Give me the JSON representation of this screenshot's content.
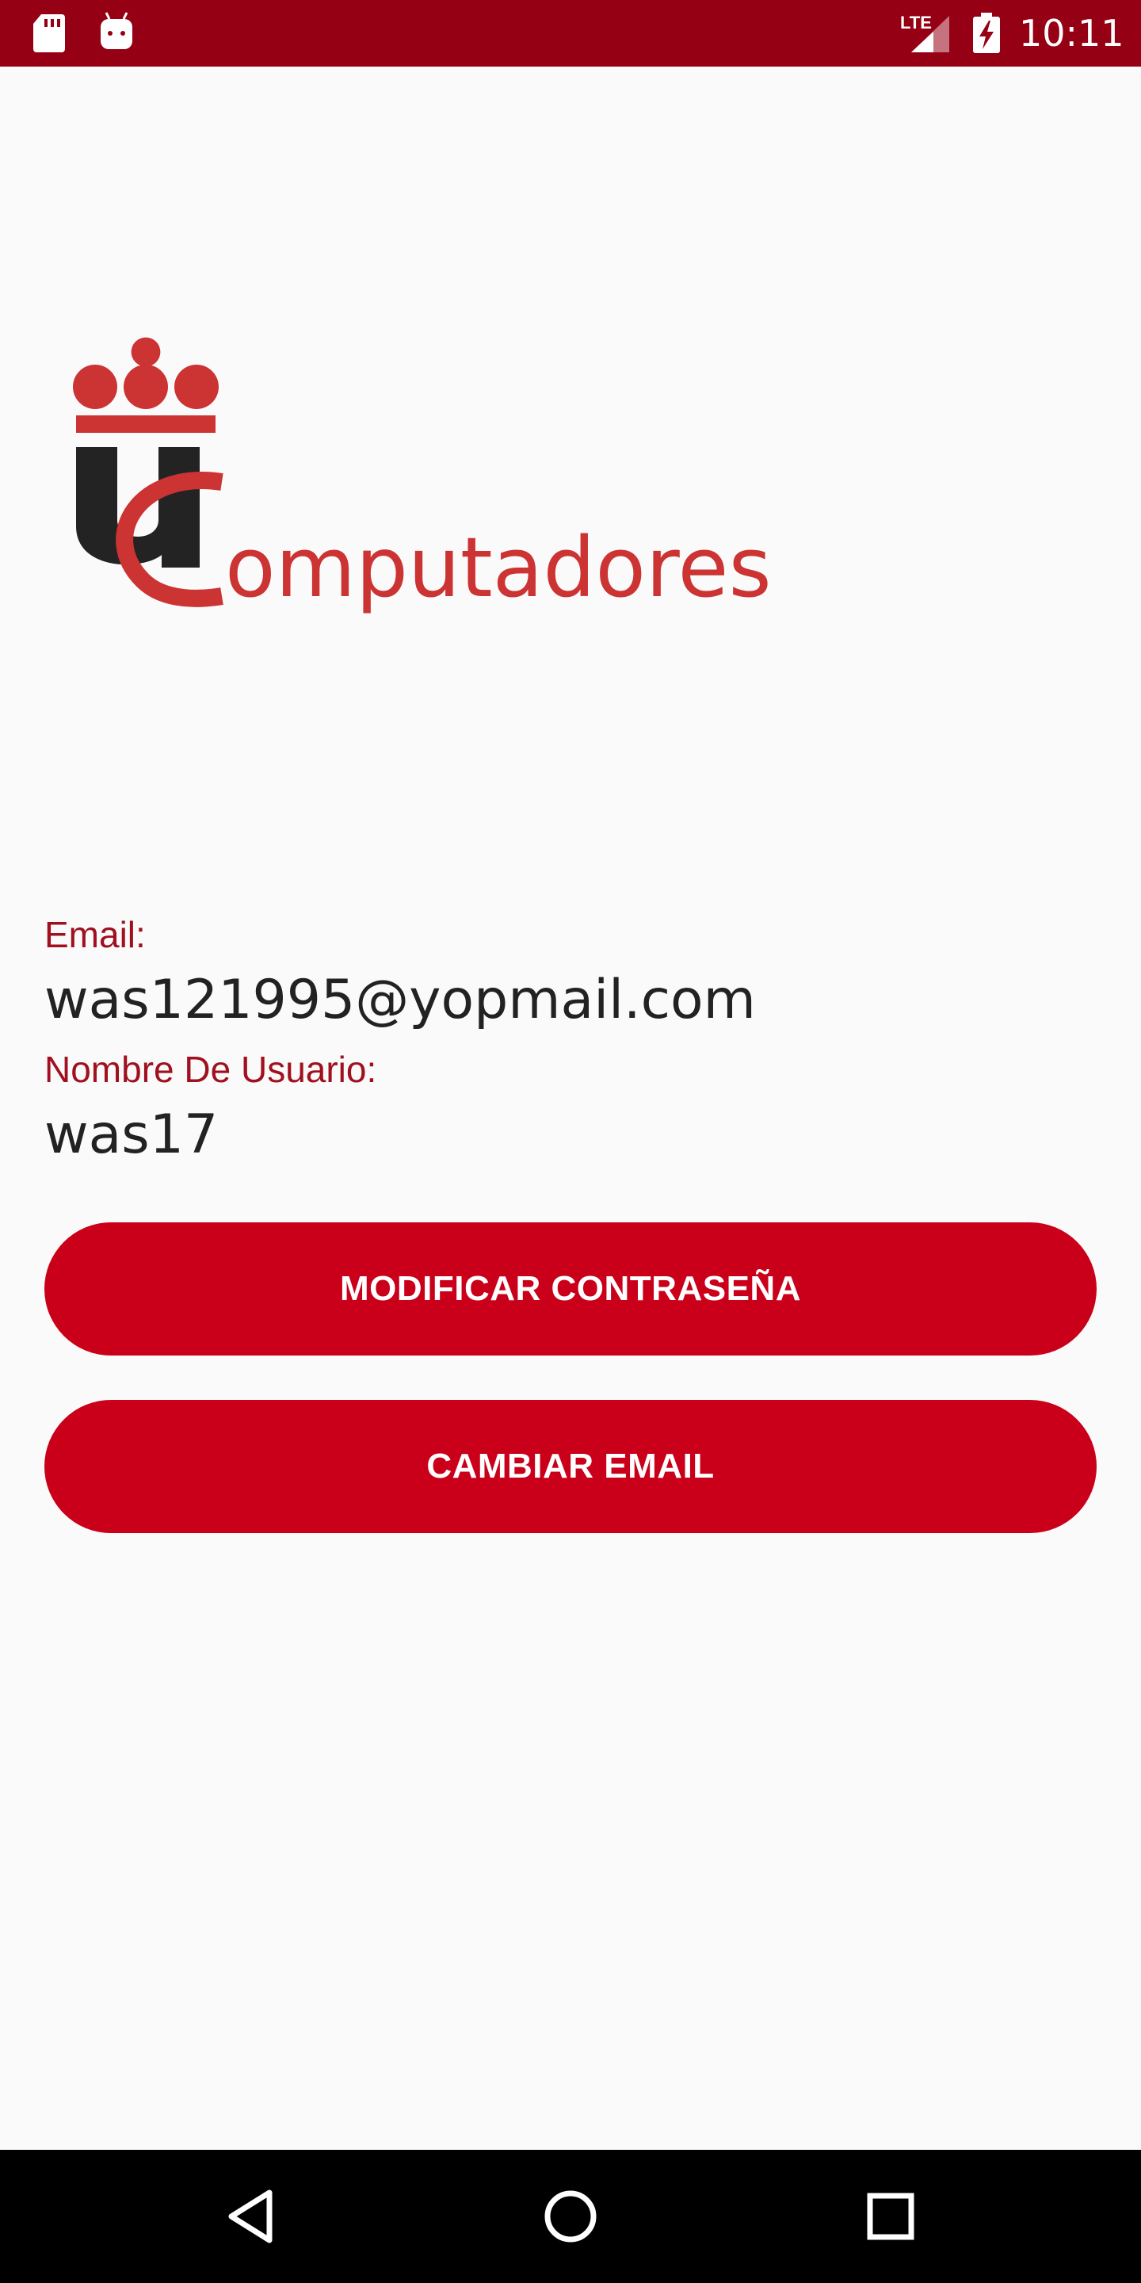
{
  "status_bar": {
    "network": "LTE",
    "time": "10:11"
  },
  "logo": {
    "wordmark": "omputadores"
  },
  "profile": {
    "email_label": "Email:",
    "email_value": "was121995@yopmail.com",
    "username_label": "Nombre De Usuario:",
    "username_value": "was17"
  },
  "buttons": {
    "change_password": "MODIFICAR CONTRASEÑA",
    "change_email": "CAMBIAR EMAIL"
  },
  "colors": {
    "status_bar": "#960014",
    "accent": "#ca001a",
    "label_text": "#a0101e",
    "logo_red": "#cc3333",
    "background": "#fafafa"
  },
  "icons": {
    "status": [
      "sd-card-icon",
      "android-debug-icon",
      "signal-icon",
      "battery-charging-icon"
    ],
    "navigation": [
      "back-icon",
      "home-icon",
      "recents-icon"
    ]
  }
}
